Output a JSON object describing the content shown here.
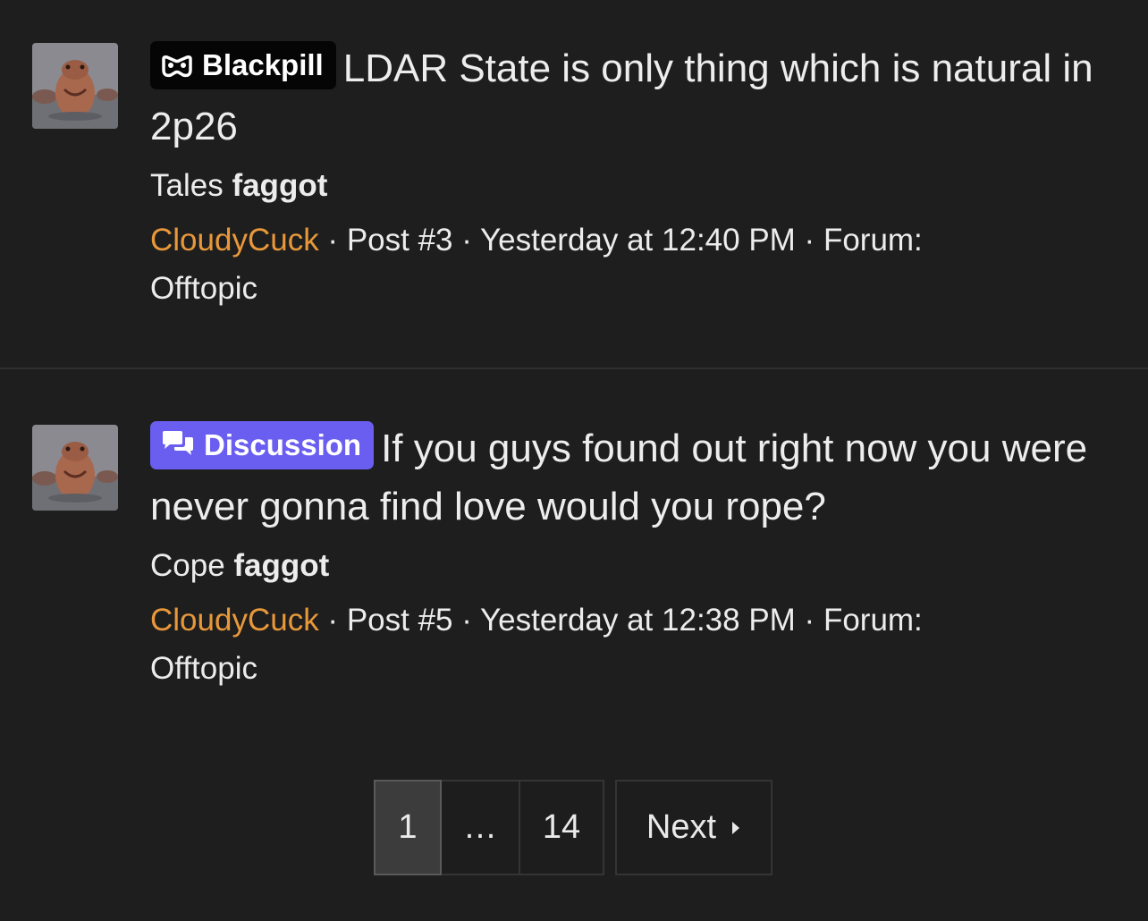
{
  "posts": [
    {
      "prefix": "Blackpill",
      "prefix_icon": "mask-icon",
      "prefix_color": "#050505",
      "title": "LDAR State is only thing which is natural in 2p26",
      "snippet_text": "Tales ",
      "snippet_highlight": "faggot",
      "author": "CloudyCuck",
      "post_number": "Post #3",
      "time": "Yesterday at 12:40 PM",
      "forum_label": "Forum:",
      "forum": "Offtopic",
      "separator": " · "
    },
    {
      "prefix": "Discussion",
      "prefix_icon": "speech-bubbles-icon",
      "prefix_color": "#6a5ef0",
      "title": "If you guys found out right now you were never gonna find love would you rope?",
      "snippet_text": "Cope ",
      "snippet_highlight": "faggot",
      "author": "CloudyCuck",
      "post_number": "Post #5",
      "time": "Yesterday at 12:38 PM",
      "forum_label": "Forum:",
      "forum": "Offtopic",
      "separator": " · "
    }
  ],
  "pagination": {
    "current": "1",
    "ellipsis": "…",
    "last": "14",
    "next_label": "Next",
    "next_icon": "caret-right-icon"
  },
  "colors": {
    "background": "#1e1e1e",
    "username": "#e8983a",
    "discussion_prefix": "#6a5ef0"
  }
}
